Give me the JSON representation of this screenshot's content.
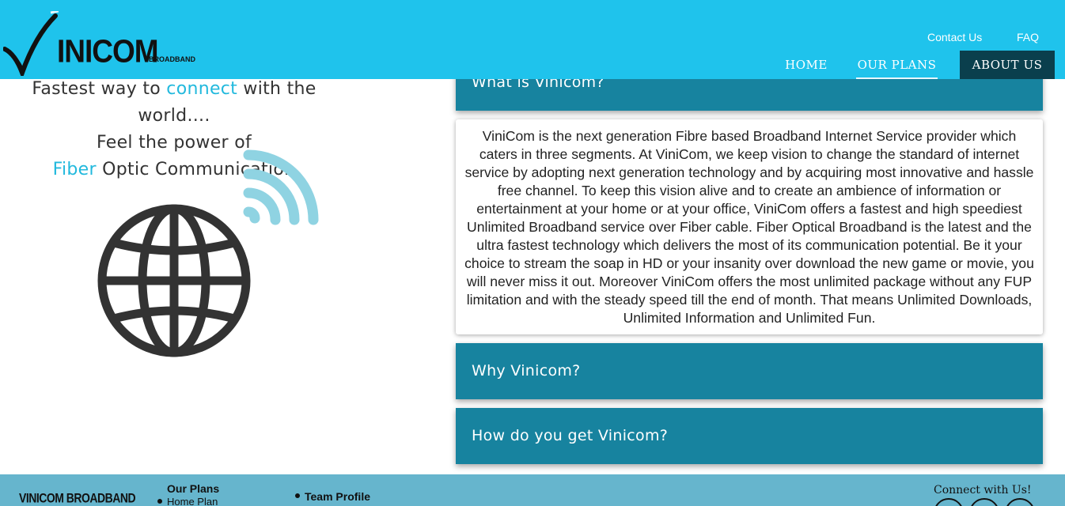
{
  "brand": {
    "name": "INICOM",
    "subtitle": "BROADBAND",
    "logo_icon": "checkmark-v-icon"
  },
  "header": {
    "top_links": [
      "Contact Us",
      "FAQ"
    ],
    "nav": [
      "HOME",
      "OUR PLANS",
      "ABOUT US"
    ],
    "active_nav": "ABOUT US"
  },
  "hero": {
    "line1_a": "Fastest way to ",
    "line1_hl": "connect",
    "line1_b": " with the",
    "line2": "world....",
    "line3": "Feel the power of",
    "line4_hl": "Fiber",
    "line4_b": " Optic Communication",
    "icons": [
      "globe-icon",
      "wifi-signal-icon"
    ]
  },
  "accordion": {
    "sections": [
      {
        "title": "What is Vinicom?",
        "expanded": true
      },
      {
        "title": "Why Vinicom?",
        "expanded": false
      },
      {
        "title": "How do you get Vinicom?",
        "expanded": false
      }
    ],
    "body": "ViniCom is the next generation Fibre based Broadband Internet Service provider which caters in three segments. At ViniCom, we keep vision to change the standard of internet service by adopting next generation technology and by acquiring most innovative and hassle free channel. To keep this vision alive and to create an ambience of information or entertainment at your home or at your office, ViniCom offers a fastest and high speediest Unlimited Broadband service over Fiber cable. Fiber Optical Broadband is the latest and the ultra fastest technology which delivers the most of its communication potential. Be it your choice to stream the soap in HD or your insanity over download the new game or movie, you will never miss it out. Moreover ViniCom offers the most unlimited package without any FUP limitation and with the steady speed till the end of month. That means Unlimited Downloads, Unlimited Information and Unlimited Fun."
  },
  "footer": {
    "brand": "VINICOM BROADBAND",
    "plans_heading": "Our Plans",
    "plans_items": [
      "Home Plan"
    ],
    "team_items": [
      "Team Profile"
    ],
    "connect_label": "Connect with Us!",
    "social_icons": [
      "facebook-icon",
      "twitter-icon",
      "google-plus-icon"
    ]
  },
  "colors": {
    "header_bg": "#1fc3ec",
    "accent": "#22b9dd",
    "accordion_bg": "#17839f",
    "active_nav_bg": "#0a3f4d",
    "footer_bg": "#66b5cd"
  }
}
